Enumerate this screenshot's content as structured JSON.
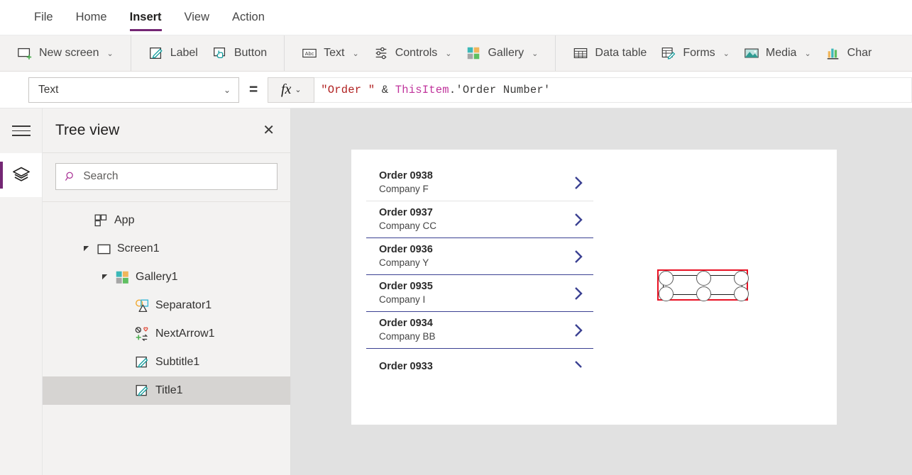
{
  "menu": {
    "tabs": [
      {
        "label": "File",
        "active": false
      },
      {
        "label": "Home",
        "active": false
      },
      {
        "label": "Insert",
        "active": true
      },
      {
        "label": "View",
        "active": false
      },
      {
        "label": "Action",
        "active": false
      }
    ]
  },
  "ribbon": {
    "items": [
      {
        "label": "New screen",
        "icon": "new-screen-icon",
        "caret": "⌄"
      },
      {
        "label": "Label",
        "icon": "label-icon",
        "caret": ""
      },
      {
        "label": "Button",
        "icon": "button-icon",
        "caret": ""
      },
      {
        "label": "Text",
        "icon": "text-abc-icon",
        "caret": "⌄"
      },
      {
        "label": "Controls",
        "icon": "controls-sliders-icon",
        "caret": "⌄"
      },
      {
        "label": "Gallery",
        "icon": "gallery-icon",
        "caret": "⌄"
      },
      {
        "label": "Data table",
        "icon": "data-table-icon",
        "caret": ""
      },
      {
        "label": "Forms",
        "icon": "forms-icon",
        "caret": "⌄"
      },
      {
        "label": "Media",
        "icon": "media-image-icon",
        "caret": "⌄"
      },
      {
        "label": "Char",
        "icon": "charts-icon",
        "caret": ""
      }
    ]
  },
  "formula_bar": {
    "property": "Text",
    "property_caret": "⌄",
    "equals": "=",
    "fx_label": "fx",
    "fx_caret": "⌄",
    "formula_tokens": [
      {
        "text": "\"Order \"",
        "type": "string"
      },
      {
        "text": " & ",
        "type": "operator"
      },
      {
        "text": "ThisItem",
        "type": "identifier"
      },
      {
        "text": ".",
        "type": "dot"
      },
      {
        "text": "'Order Number'",
        "type": "field"
      }
    ]
  },
  "rail": {
    "hamburger": "hamburger-icon",
    "active_tool": "tree-view-layers-icon"
  },
  "tree_panel": {
    "title": "Tree view",
    "close_label": "✕",
    "search_placeholder": "Search",
    "search_value": "",
    "nodes": [
      {
        "label": "App",
        "icon": "app-icon",
        "indent": 0,
        "caret": "",
        "selected": false
      },
      {
        "label": "Screen1",
        "icon": "screen-icon",
        "indent": 0,
        "caret": "▾",
        "selected": false
      },
      {
        "label": "Gallery1",
        "icon": "gallery-icon",
        "indent": 1,
        "caret": "▾",
        "selected": false
      },
      {
        "label": "Separator1",
        "icon": "separator-icon",
        "indent": 2,
        "caret": "",
        "selected": false
      },
      {
        "label": "NextArrow1",
        "icon": "nextarrow-icon",
        "indent": 2,
        "caret": "",
        "selected": false
      },
      {
        "label": "Subtitle1",
        "icon": "label-icon",
        "indent": 2,
        "caret": "",
        "selected": false
      },
      {
        "label": "Title1",
        "icon": "label-icon",
        "indent": 2,
        "caret": "",
        "selected": true
      }
    ]
  },
  "canvas": {
    "gallery_items": [
      {
        "title": "Order 0938",
        "subtitle": "Company F",
        "chevron": "nextarrow-chevron",
        "selected": true
      },
      {
        "title": "Order 0937",
        "subtitle": "Company CC",
        "chevron": "nextarrow-chevron",
        "selected": false
      },
      {
        "title": "Order 0936",
        "subtitle": "Company Y",
        "chevron": "nextarrow-chevron",
        "selected": false
      },
      {
        "title": "Order 0935",
        "subtitle": "Company I",
        "chevron": "nextarrow-chevron",
        "selected": false
      },
      {
        "title": "Order 0934",
        "subtitle": "Company BB",
        "chevron": "nextarrow-chevron",
        "selected": false
      },
      {
        "title": "Order 0933",
        "subtitle": "",
        "chevron": "nextarrow-chevron",
        "selected": false
      }
    ]
  },
  "colors": {
    "accent_purple": "#742774",
    "selection_red": "#e81123",
    "gallery_separator": "#3b4192",
    "chevron_blue": "#3b4192",
    "ribbon_bg": "#f3f2f1",
    "canvas_bg": "#e1e1e1"
  }
}
